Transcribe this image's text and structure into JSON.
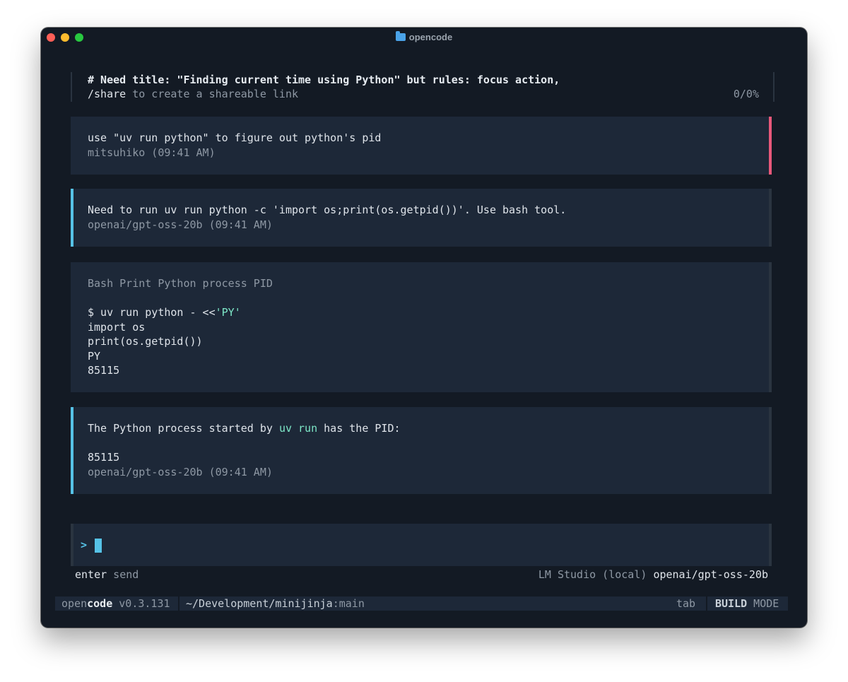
{
  "window": {
    "title": "opencode",
    "title_icon": "folder-icon"
  },
  "header": {
    "title": "# Need title: \"Finding current time using Python\" but rules: focus action,",
    "share_cmd": "/share",
    "share_text": " to create a shareable link",
    "context_usage": "0/0%"
  },
  "messages": [
    {
      "role": "user",
      "text": "use \"uv run python\" to figure out python's pid",
      "meta": "mitsuhiko (09:41 AM)"
    },
    {
      "role": "assistant",
      "text": "Need to run uv run python -c 'import os;print(os.getpid())'. Use bash tool.",
      "meta": "openai/gpt-oss-20b (09:41 AM)"
    },
    {
      "role": "tool",
      "title": "Bash Print Python process PID",
      "command_prefix": "$ uv run python - <<",
      "command_heredoc": "'PY'",
      "lines": [
        "import os",
        "print(os.getpid())",
        "PY",
        "85115"
      ]
    },
    {
      "role": "assistant",
      "text_before": "The Python process started by ",
      "code": "uv run",
      "text_after": " has the PID:",
      "value": "85115",
      "meta": "openai/gpt-oss-20b (09:41 AM)"
    }
  ],
  "input": {
    "prompt": ">",
    "value": ""
  },
  "hints": {
    "send": "enter",
    "send_label": " send",
    "provider": "LM Studio (local) ",
    "model": "openai/gpt-oss-20b"
  },
  "statusbar": {
    "app_name_1": "open",
    "app_name_2": "code",
    "version": " v0.3.131",
    "path": "~/Development/minijinja",
    "branch": ":main",
    "tab_hint": "tab",
    "mode_1": "BUILD",
    "mode_2": " MODE"
  },
  "colors": {
    "background": "#131a24",
    "panel": "#1d2838",
    "accent": "#56c2e6",
    "user_accent": "#e8587a",
    "code": "#7ee8c8"
  }
}
